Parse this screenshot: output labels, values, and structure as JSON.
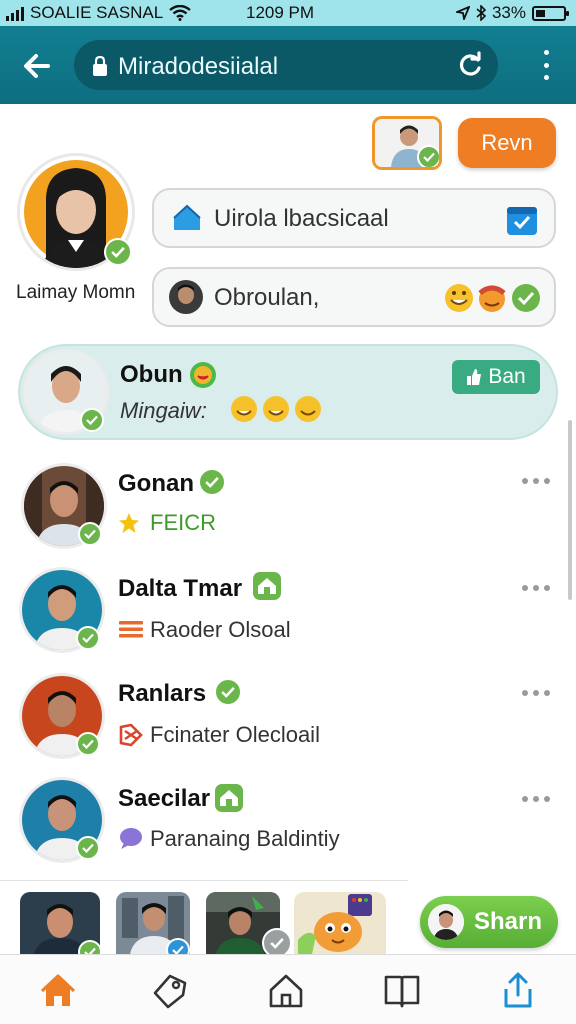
{
  "status_bar": {
    "carrier": "SOALIE SASNAL",
    "time": "1209 PM",
    "battery": "33%",
    "battery_level": 0.33
  },
  "toolbar": {
    "address": "Mirаdodesiialal"
  },
  "header_action": {
    "button_label": "Revn"
  },
  "profile": {
    "name": "Laimay Momn",
    "fields": [
      {
        "text": "Uirola lbacsicaal"
      },
      {
        "text": "Obroulan,"
      }
    ]
  },
  "contacts": [
    {
      "name": "Obun",
      "subtitle": "Mingaiw:",
      "action": "Ban",
      "highlighted": true,
      "avatar_bg": "#e6eef0"
    },
    {
      "name": "Gonan",
      "subtitle": "FEICR",
      "subtitle_color": "#3e9a2b",
      "avatar_bg": "#5a3a2a"
    },
    {
      "name": "Dalta Tmar",
      "subtitle": "Raoder Olsoal",
      "avatar_bg": "#1a86a8"
    },
    {
      "name": "Ranlars",
      "subtitle": "Fcinater Olecloail",
      "avatar_bg": "#c7461e"
    },
    {
      "name": "Saecilar",
      "subtitle": "Paranaing Baldintiy",
      "avatar_bg": "#1e7fa8"
    }
  ],
  "share": {
    "label": "Sharn"
  },
  "colors": {
    "appbar": "#0f7587",
    "accent_orange": "#ee7d24",
    "verified_green": "#6bb64a",
    "ban_green": "#3aaa82"
  },
  "icons": [
    "back-arrow-icon",
    "lock-icon",
    "reload-icon",
    "more-vert-icon",
    "home-icon",
    "tag-icon",
    "house-outline-icon",
    "book-icon",
    "share-icon"
  ]
}
